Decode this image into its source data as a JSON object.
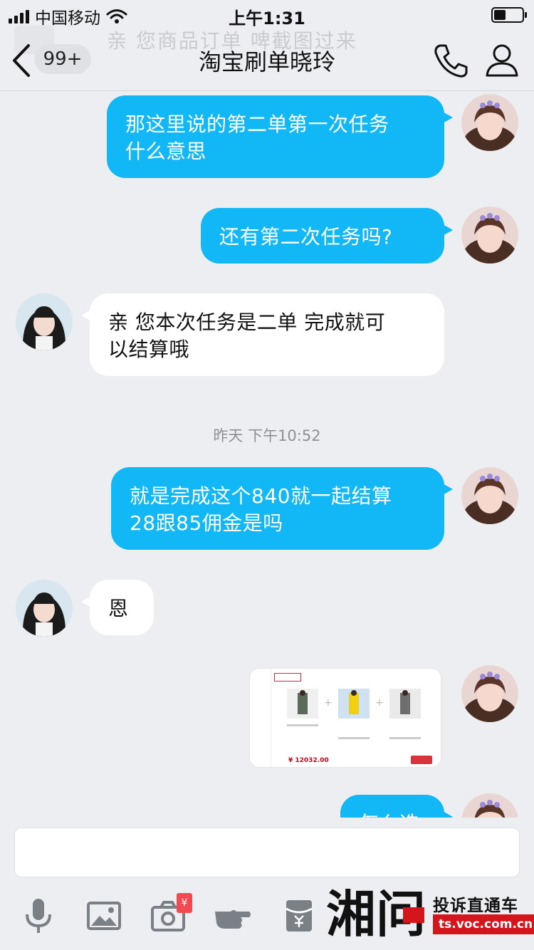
{
  "status_bar": {
    "carrier": "中国移动",
    "time": "上午1:31"
  },
  "notification_ghost": "亲 您商品订单 啤截图过来",
  "header": {
    "unread_badge": "99+",
    "title": "淘宝刷单晓玲",
    "icons": [
      "back-chevron-icon",
      "phone-icon",
      "profile-icon"
    ]
  },
  "messages": [
    {
      "side": "out",
      "text_line1": "那这里说的第二单第一次任务",
      "text_line2": "什么意思"
    },
    {
      "side": "out",
      "text": "还有第二次任务吗?"
    },
    {
      "side": "in",
      "text_line1": "亲 您本次任务是二单  完成就可",
      "text_line2": "以结算哦"
    },
    {
      "timestamp": "昨天 下午10:52"
    },
    {
      "side": "out",
      "text_line1": "就是完成这个840就一起结算",
      "text_line2": "28跟85佣金是吗"
    },
    {
      "side": "in",
      "text": "恩"
    },
    {
      "side": "out",
      "type": "image",
      "price_text": "¥ 12032.00"
    },
    {
      "side": "out",
      "partial_text": "怎么选"
    }
  ],
  "composer": {
    "input_value": ""
  },
  "toolbar_icons": [
    "microphone-icon",
    "image-icon",
    "camera-icon",
    "red-packet-badge",
    "poke-hand-icon",
    "wallet-icon"
  ],
  "watermark": {
    "logo_text": "湘问",
    "slogan": "投诉直通车",
    "url": "ts.voc.com.cn"
  },
  "colors": {
    "bubble_out": "#12b7f5",
    "bubble_in": "#ffffff",
    "background": "#eceef1",
    "watermark_red": "#d5151c"
  }
}
